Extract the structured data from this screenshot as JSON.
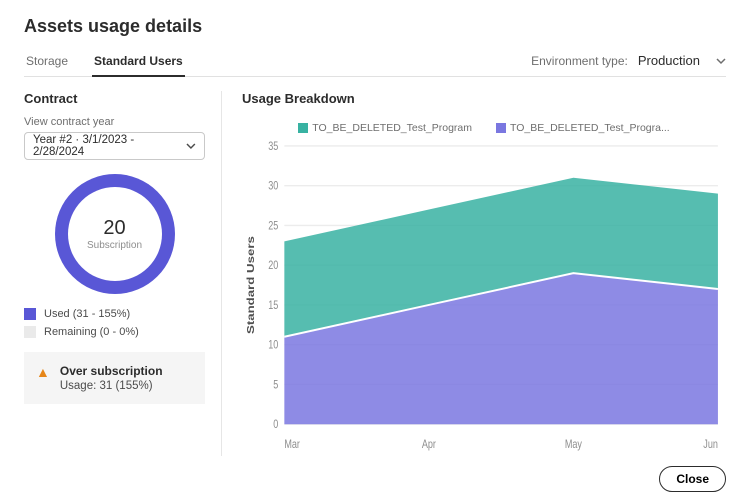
{
  "title": "Assets usage details",
  "tabs": {
    "storage": "Storage",
    "standardUsers": "Standard Users"
  },
  "env": {
    "label": "Environment type:",
    "value": "Production"
  },
  "contract": {
    "heading": "Contract",
    "yearLabel": "View contract year",
    "yearValue": "Year #2  ·  3/1/2023 - 2/28/2024",
    "subscriptionCount": "20",
    "subscriptionLabel": "Subscription",
    "usedLabel": "Used (31 - 155%)",
    "remainingLabel": "Remaining (0 - 0%)",
    "alertTitle": "Over subscription",
    "alertDetail": "Usage: 31 (155%)"
  },
  "breakdown": {
    "heading": "Usage Breakdown",
    "legendA": "TO_BE_DELETED_Test_Program",
    "legendB": "TO_BE_DELETED_Test_Progra...",
    "yAxisLabel": "Standard Users"
  },
  "chart_data": {
    "type": "area",
    "stacked": true,
    "xlabel": "",
    "ylabel": "Standard Users",
    "ylim": [
      0,
      35
    ],
    "yticks": [
      0.0,
      5,
      10,
      15,
      20,
      25,
      30,
      35
    ],
    "categories": [
      "Mar",
      "Apr",
      "May",
      "Jun"
    ],
    "series": [
      {
        "name": "TO_BE_DELETED_Test_Progra...",
        "color": "#7a77e0",
        "values": [
          11,
          15,
          19,
          17
        ]
      },
      {
        "name": "TO_BE_DELETED_Test_Program",
        "color": "#38b2a2",
        "values": [
          12,
          12,
          12,
          12
        ]
      }
    ]
  },
  "footer": {
    "close": "Close"
  }
}
